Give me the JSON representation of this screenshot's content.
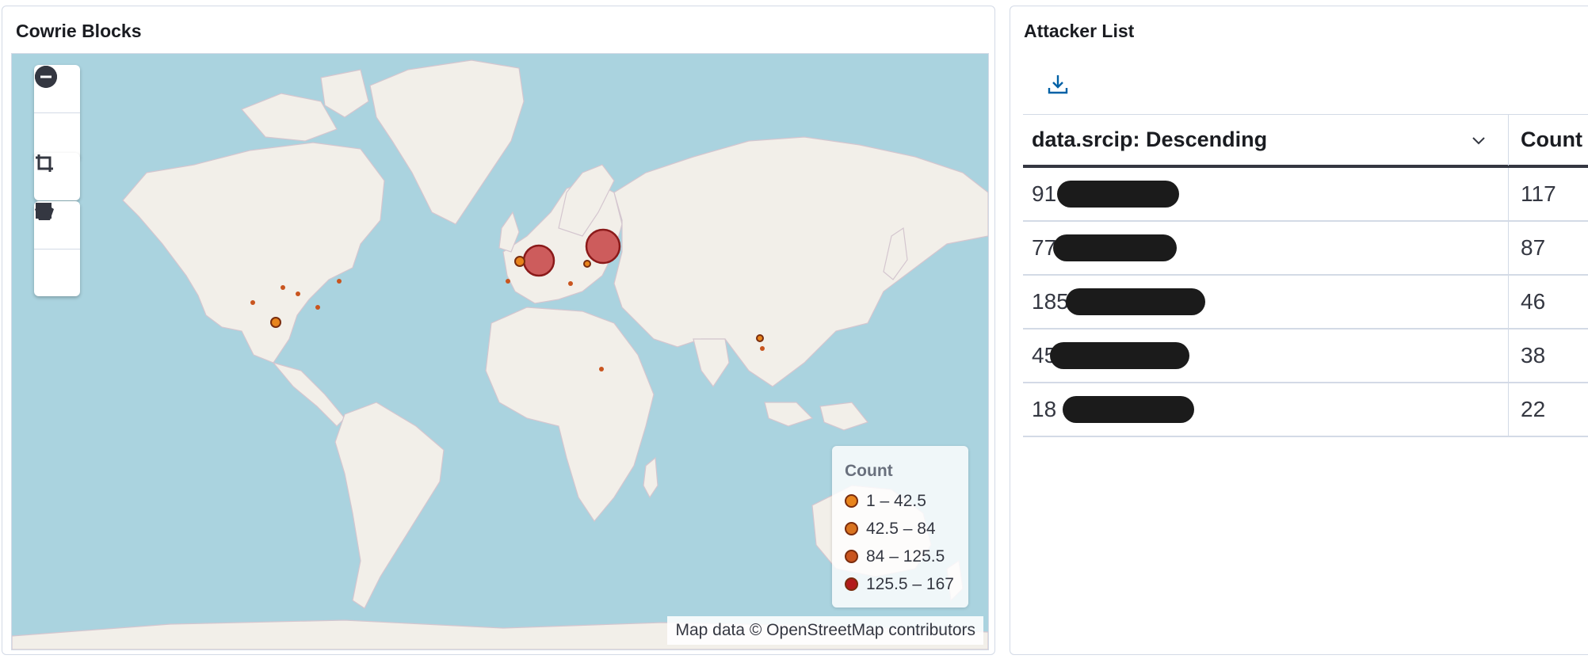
{
  "map_panel": {
    "title": "Cowrie Blocks",
    "toolbar": {
      "zoom_in_icon": "plus-circle-icon",
      "zoom_out_icon": "minus-circle-icon",
      "crop_icon": "crop-icon",
      "polygon_icon": "pentagon-icon",
      "rectangle_icon": "square-icon"
    },
    "legend": {
      "title": "Count",
      "items": [
        {
          "label": "1 – 42.5",
          "color": "#e8841c"
        },
        {
          "label": "42.5 – 84",
          "color": "#d9731f"
        },
        {
          "label": "84 – 125.5",
          "color": "#c9551f"
        },
        {
          "label": "125.5 – 167",
          "color": "#b21c1c"
        }
      ]
    },
    "attribution": "Map data © OpenStreetMap contributors",
    "colors": {
      "water": "#aad3df",
      "land": "#f2efe9",
      "large_marker": "#cd5c5c"
    }
  },
  "table_panel": {
    "title": "Attacker List",
    "download_icon": "download-icon",
    "columns": {
      "ip": "data.srcip: Descending",
      "count": "Count"
    },
    "sort_icon": "chevron-down-icon",
    "rows": [
      {
        "ip": "91",
        "count": "117"
      },
      {
        "ip": "77",
        "count": "87"
      },
      {
        "ip": "185",
        "count": "46"
      },
      {
        "ip": "45",
        "count": "38"
      },
      {
        "ip": "18",
        "count": "22"
      }
    ]
  }
}
